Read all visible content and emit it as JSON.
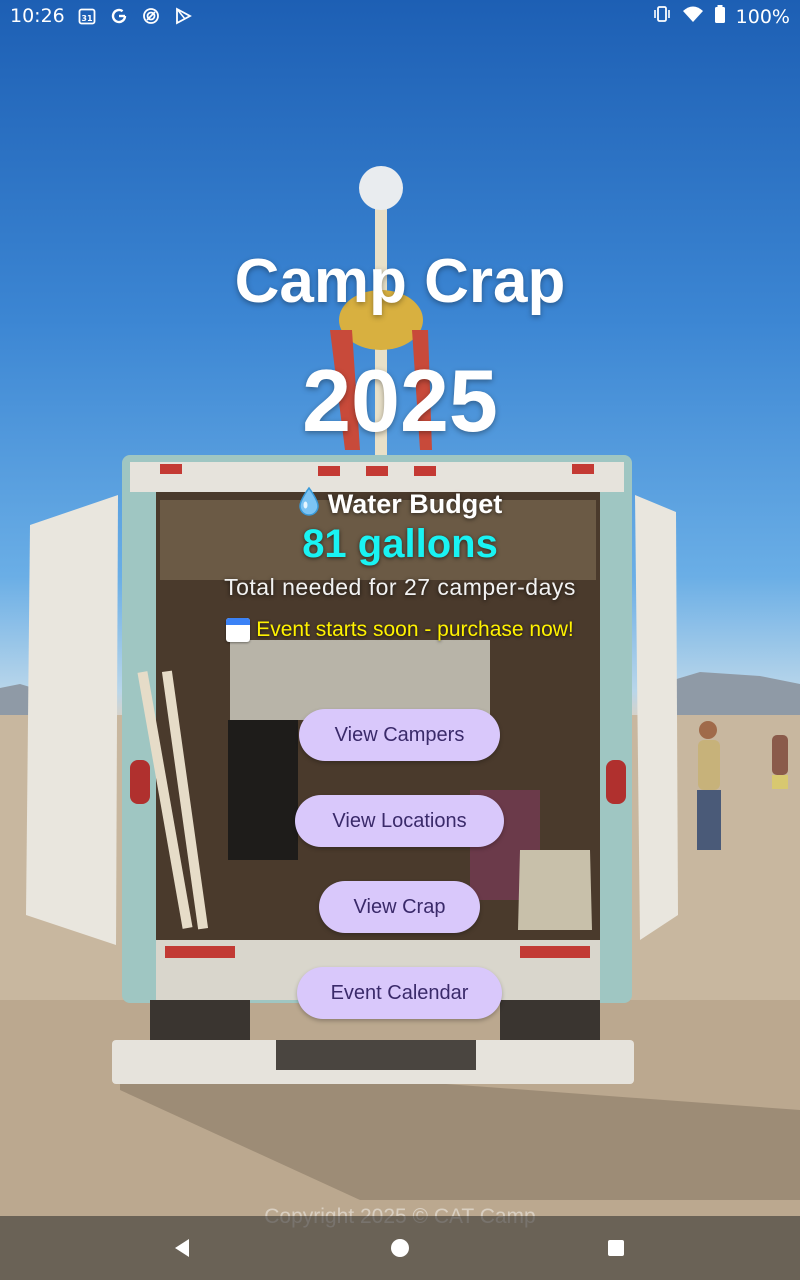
{
  "status_bar": {
    "time": "10:26",
    "battery": "100%",
    "left_icons": [
      "calendar-icon",
      "google-icon",
      "sync-icon",
      "play-icon"
    ],
    "right_icons": [
      "vibrate-icon",
      "wifi-icon",
      "battery-icon"
    ]
  },
  "header": {
    "title": "Camp Crap",
    "year": "2025"
  },
  "water": {
    "icon": "water-drop-icon",
    "label": "Water Budget",
    "value": "81 gallons",
    "subtitle": "Total needed for 27 camper-days"
  },
  "alert": {
    "icon": "calendar-icon",
    "text": "Event starts soon - purchase now!"
  },
  "buttons": {
    "campers": "View Campers",
    "locations": "View Locations",
    "crap": "View Crap",
    "calendar": "Event Calendar"
  },
  "footer": {
    "copyright": "Copyright 2025 © CAT Camp"
  },
  "colors": {
    "water_value": "#19f3f3",
    "alert_text": "#fff200",
    "button_bg": "#d9c8fb",
    "button_text": "#3a2a6a"
  }
}
